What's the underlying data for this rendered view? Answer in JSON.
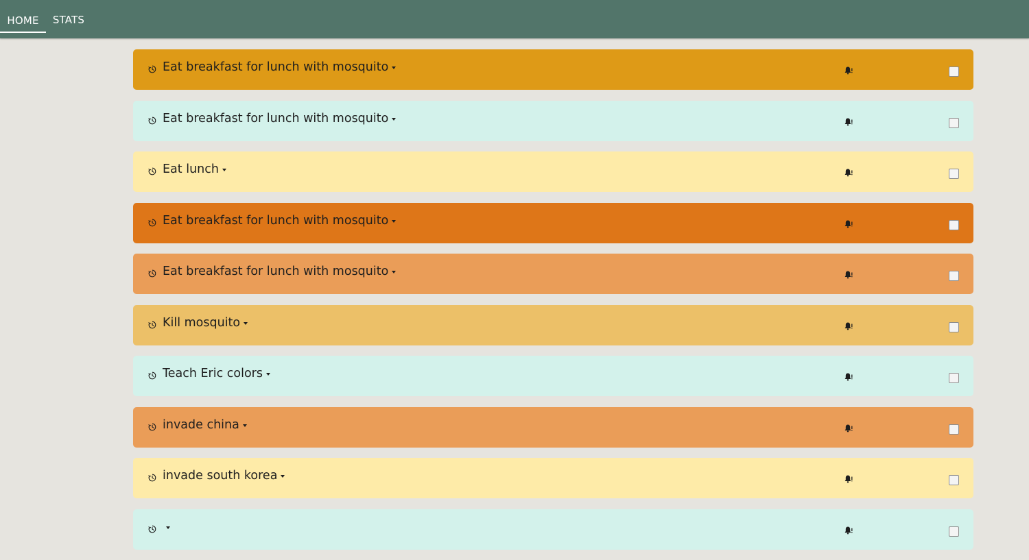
{
  "nav": {
    "tabs": [
      {
        "label": "HOME",
        "active": true
      },
      {
        "label": "STATS",
        "active": false
      }
    ]
  },
  "colors": {
    "navbar": "#52756a",
    "background": "#e6e4df",
    "gold": "#de9a17",
    "mint": "#d3f2eb",
    "pale_yellow": "#feeba8",
    "dark_orange": "#de7618",
    "light_orange": "#ea9d58",
    "sand": "#ecc068"
  },
  "tasks": [
    {
      "title": "Eat breakfast for lunch with mosquito",
      "color": "#de9a17",
      "checked": false,
      "clock_icon": "clock-icon",
      "bell_icon": "bell-icon"
    },
    {
      "title": "Eat breakfast for lunch with mosquito",
      "color": "#d3f2eb",
      "checked": false,
      "clock_icon": "clock-icon",
      "bell_icon": "bell-icon"
    },
    {
      "title": "Eat lunch",
      "color": "#feeba8",
      "checked": false,
      "clock_icon": "clock-icon",
      "bell_icon": "bell-icon"
    },
    {
      "title": "Eat breakfast for lunch with mosquito",
      "color": "#de7618",
      "checked": false,
      "clock_icon": "clock-icon",
      "bell_icon": "bell-icon"
    },
    {
      "title": "Eat breakfast for lunch with mosquito",
      "color": "#ea9d58",
      "checked": false,
      "clock_icon": "clock-icon",
      "bell_icon": "bell-icon"
    },
    {
      "title": "Kill mosquito",
      "color": "#ecc068",
      "checked": false,
      "clock_icon": "clock-icon",
      "bell_icon": "bell-icon"
    },
    {
      "title": "Teach Eric colors",
      "color": "#d3f2eb",
      "checked": false,
      "clock_icon": "clock-icon",
      "bell_icon": "bell-icon"
    },
    {
      "title": "invade china",
      "color": "#ea9d58",
      "checked": false,
      "clock_icon": "clock-icon",
      "bell_icon": "bell-icon"
    },
    {
      "title": "invade south korea",
      "color": "#feeba8",
      "checked": false,
      "clock_icon": "clock-icon",
      "bell_icon": "bell-icon"
    },
    {
      "title": "",
      "color": "#d3f2eb",
      "checked": false,
      "clock_icon": "clock-icon",
      "bell_icon": "bell-icon"
    }
  ]
}
